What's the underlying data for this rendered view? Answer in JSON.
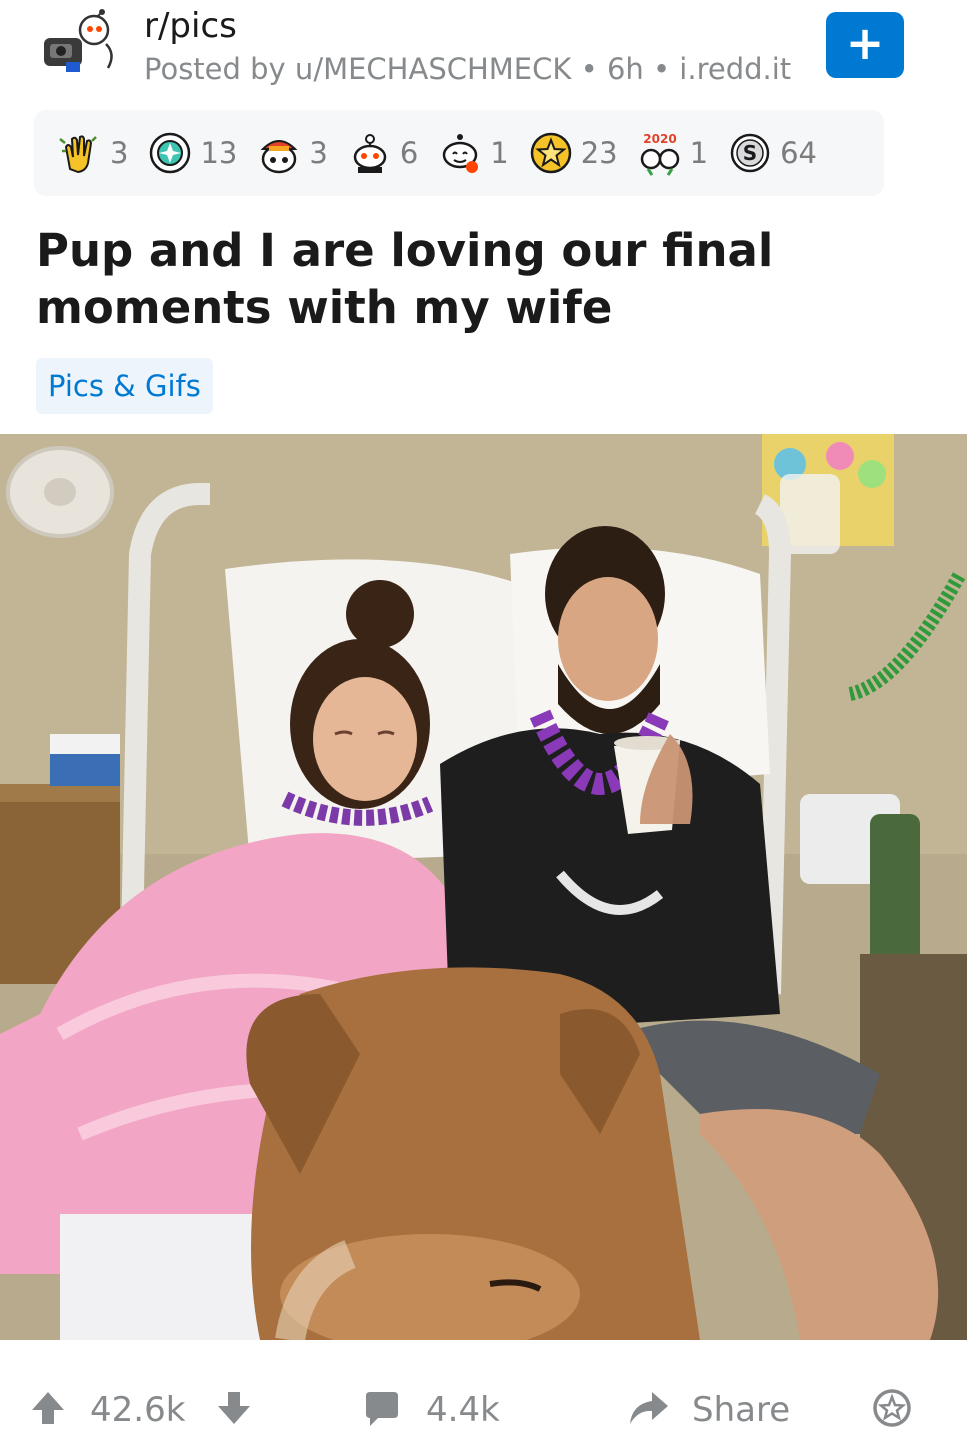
{
  "post": {
    "subreddit": "r/pics",
    "meta": "Posted by u/MECHASCHMECK • 6h • i.redd.it",
    "join_symbol": "+",
    "title": "Pup and I are loving our final moments with my wife",
    "flair": "Pics & Gifs"
  },
  "awards": [
    {
      "icon": "wholesome-hands-icon",
      "count": "3"
    },
    {
      "icon": "gem-shield-icon",
      "count": "13"
    },
    {
      "icon": "snoo-hat-icon",
      "count": "3"
    },
    {
      "icon": "snoo-crew-icon",
      "count": "6"
    },
    {
      "icon": "snoo-hug-icon",
      "count": "1"
    },
    {
      "icon": "gold-star-icon",
      "count": "23"
    },
    {
      "icon": "2020-glasses-icon",
      "count": "1"
    },
    {
      "icon": "silver-coin-icon",
      "count": "64"
    }
  ],
  "award_badge_text": "2020",
  "actions": {
    "upvotes": "42.6k",
    "comments": "4.4k",
    "share": "Share"
  },
  "colors": {
    "accent": "#0079d3",
    "flair_bg": "#eef4fb",
    "muted_text": "#878a8c",
    "awards_bg": "#f6f7f8"
  }
}
